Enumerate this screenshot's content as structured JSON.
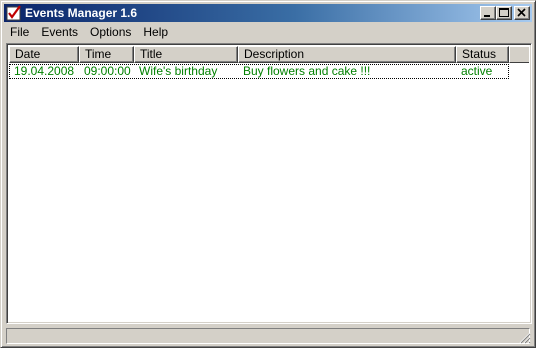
{
  "window": {
    "title": "Events Manager 1.6",
    "app_icon": "checkmark-app-icon",
    "controls": {
      "minimize_icon": "minimize-icon",
      "maximize_icon": "maximize-icon",
      "close_icon": "close-icon"
    }
  },
  "menu": {
    "items": [
      {
        "label": "File"
      },
      {
        "label": "Events"
      },
      {
        "label": "Options"
      },
      {
        "label": "Help"
      }
    ]
  },
  "table": {
    "columns": [
      {
        "label": "Date"
      },
      {
        "label": "Time"
      },
      {
        "label": "Title"
      },
      {
        "label": "Description"
      },
      {
        "label": "Status"
      }
    ],
    "rows": [
      {
        "date": "19.04.2008",
        "time": "09:00:00",
        "title": "Wife's birthday",
        "description": "Buy flowers and cake !!!",
        "status": "active",
        "color": "#008000"
      }
    ]
  },
  "statusbar": {
    "text": "",
    "grip_icon": "resize-grip-icon"
  },
  "colors": {
    "titlebar_start": "#0a246a",
    "titlebar_end": "#a6caf0",
    "row_text": "#008000",
    "face": "#d4d0c8"
  }
}
